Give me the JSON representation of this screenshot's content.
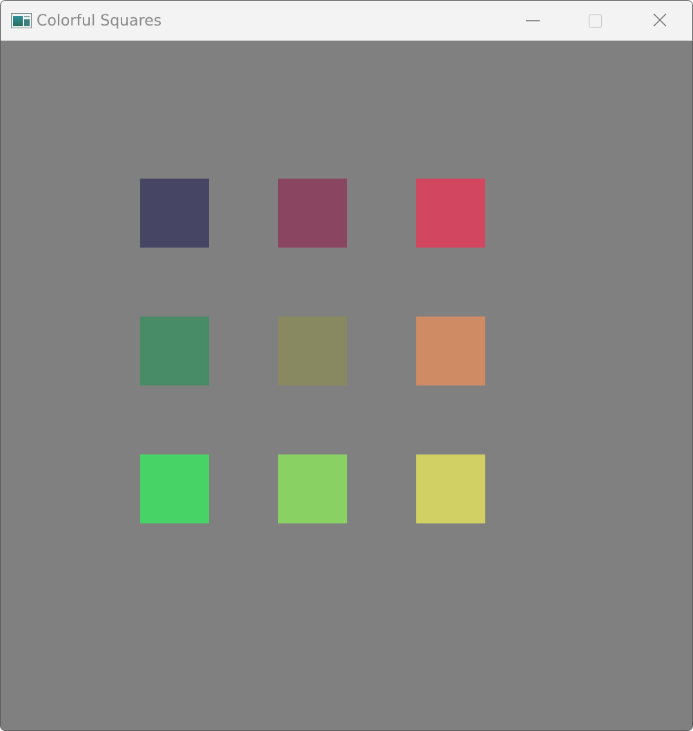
{
  "window": {
    "title": "Colorful Squares",
    "background": "#808080",
    "controls": [
      "minimize-icon",
      "maximize-icon",
      "close-icon"
    ]
  },
  "canvas": {
    "rows": 3,
    "columns": 3,
    "squares": [
      {
        "row": 1,
        "col": 1,
        "color": "#464564"
      },
      {
        "row": 1,
        "col": 2,
        "color": "#8a4560"
      },
      {
        "row": 1,
        "col": 3,
        "color": "#d34660"
      },
      {
        "row": 2,
        "col": 1,
        "color": "#478b67"
      },
      {
        "row": 2,
        "col": 2,
        "color": "#888960"
      },
      {
        "row": 2,
        "col": 3,
        "color": "#cf8b63"
      },
      {
        "row": 3,
        "col": 1,
        "color": "#47d366"
      },
      {
        "row": 3,
        "col": 2,
        "color": "#8ad164"
      },
      {
        "row": 3,
        "col": 3,
        "color": "#d0d064"
      }
    ]
  }
}
